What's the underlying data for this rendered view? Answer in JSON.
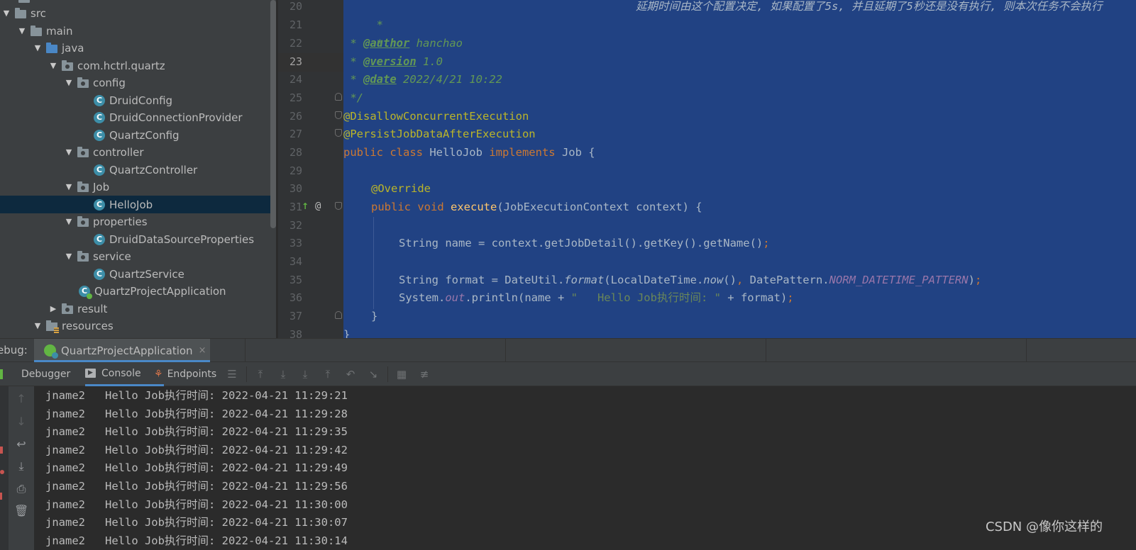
{
  "tree": {
    "items": [
      {
        "label": "src",
        "type": "folder",
        "expanded": true
      },
      {
        "label": "main",
        "type": "folder",
        "expanded": true
      },
      {
        "label": "java",
        "type": "source-folder",
        "expanded": true
      },
      {
        "label": "com.hctrl.quartz",
        "type": "package",
        "expanded": true
      },
      {
        "label": "config",
        "type": "package",
        "expanded": true
      },
      {
        "label": "DruidConfig",
        "type": "class"
      },
      {
        "label": "DruidConnectionProvider",
        "type": "class"
      },
      {
        "label": "QuartzConfig",
        "type": "class"
      },
      {
        "label": "controller",
        "type": "package",
        "expanded": true
      },
      {
        "label": "QuartzController",
        "type": "class"
      },
      {
        "label": "Job",
        "type": "package",
        "expanded": true
      },
      {
        "label": "HelloJob",
        "type": "class",
        "selected": true
      },
      {
        "label": "properties",
        "type": "package",
        "expanded": true
      },
      {
        "label": "DruidDataSourceProperties",
        "type": "class"
      },
      {
        "label": "service",
        "type": "package",
        "expanded": true
      },
      {
        "label": "QuartzService",
        "type": "class"
      },
      {
        "label": "QuartzProjectApplication",
        "type": "spring-app"
      },
      {
        "label": "result",
        "type": "package",
        "expanded": false
      },
      {
        "label": "resources",
        "type": "resources-folder",
        "expanded": true
      }
    ]
  },
  "editor": {
    "line_numbers": [
      "20",
      "21",
      "22",
      "23",
      "24",
      "25",
      "26",
      "27",
      "28",
      "29",
      "30",
      "31",
      "32",
      "33",
      "34",
      "35",
      "36",
      "37",
      "38"
    ],
    "current_line": "23",
    "code": {
      "l20_star": " *",
      "l20_comment": "延期时间由这个配置决定, 如果配置了5s, 并且延期了5秒还是没有执行, 则本次任务不会执行",
      "l21": " *",
      "l22_prefix": " * ",
      "l22_tag": "@author",
      "l22_val": " hanchao",
      "l23_prefix": " * ",
      "l23_tag": "@version",
      "l23_val": " 1.0",
      "l24_prefix": " * ",
      "l24_tag": "@date",
      "l24_val": " 2022/4/21 10:22",
      "l25": " */",
      "l26": "@DisallowConcurrentExecution",
      "l27": "@PersistJobDataAfterExecution",
      "l28_kw1": "public class",
      "l28_name": " HelloJob ",
      "l28_kw2": "implements",
      "l28_rest": " Job {",
      "l30": "@Override",
      "l31_kw": "public void",
      "l31_fn": "execute",
      "l31_rest": "(JobExecutionContext context) {",
      "l33_a": "String name = context.getJobDetail().getKey().getName()",
      "l33_semi": ";",
      "l35_a": "String format = DateUtil.",
      "l35_fmt": "format",
      "l35_b": "(LocalDateTime.",
      "l35_now": "now",
      "l35_c": "()",
      "l35_comma": ",",
      "l35_d": " DatePattern.",
      "l35_const": "NORM_DATETIME_PATTERN",
      "l35_e": ")",
      "l35_semi": ";",
      "l36_a": "System.",
      "l36_out": "out",
      "l36_b": ".println(name + ",
      "l36_str": "\"   Hello Job执行时间: \"",
      "l36_c": " + format)",
      "l36_semi": ";",
      "l37": "}",
      "l38": "}"
    }
  },
  "debug": {
    "label": "ebug:",
    "tab_label": "QuartzProjectApplication",
    "close": "×"
  },
  "toolbar": {
    "debugger": "Debugger",
    "console": "Console",
    "endpoints": "Endpoints"
  },
  "console": {
    "lines": [
      "jname2   Hello Job执行时间: 2022-04-21 11:29:21",
      "jname2   Hello Job执行时间: 2022-04-21 11:29:28",
      "jname2   Hello Job执行时间: 2022-04-21 11:29:35",
      "jname2   Hello Job执行时间: 2022-04-21 11:29:42",
      "jname2   Hello Job执行时间: 2022-04-21 11:29:49",
      "jname2   Hello Job执行时间: 2022-04-21 11:29:56",
      "jname2   Hello Job执行时间: 2022-04-21 11:30:00",
      "jname2   Hello Job执行时间: 2022-04-21 11:30:07",
      "jname2   Hello Job执行时间: 2022-04-21 11:30:14"
    ]
  },
  "watermark": "CSDN @像你这样的",
  "colors": {
    "tree_bg": "#3c3f41",
    "editor_selection": "#214283",
    "console_bg": "#2b2b2b",
    "accent": "#4a88c7"
  }
}
